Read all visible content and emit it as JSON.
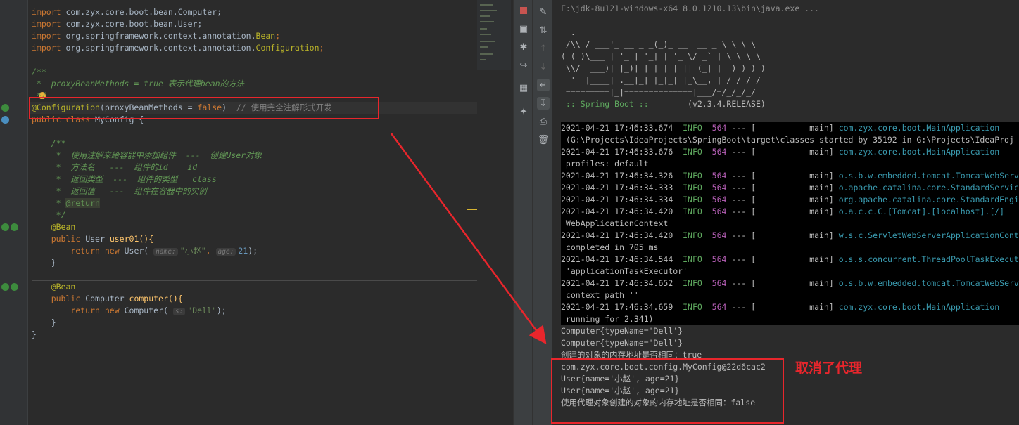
{
  "editor": {
    "imports": [
      "com.zyx.core.boot.bean.Computer;",
      "com.zyx.core.boot.bean.User;",
      "org.springframework.context.annotation.",
      "org.springframework.context.annotation."
    ],
    "import_kw": "import",
    "import_bean": "Bean",
    "import_conf": "Configuration",
    "semicolon": ";",
    "doc_open": "/**",
    "doc_proxy": " *  proxyBeanMethods = true 表示代理bean的方法",
    "doc_close": " */",
    "config_ann": "@Configuration",
    "config_param": "proxyBeanMethods",
    "config_eq": " = ",
    "config_val": "false",
    "config_close": ")",
    "config_open": "(",
    "config_comment": "// 使用完全注解形式开发",
    "class_decl_kw1": "public",
    "class_decl_kw2": "class",
    "class_name": "MyConfig",
    "brace_open": " {",
    "jd1": " *  使用注解来给容器中添加组件  ---  创建User对象",
    "jd2": " *  方法名   ---  组件的id    id",
    "jd3": " *  返回类型  ---  组件的类型   class",
    "jd4": " *  返回值   ---  组件在容器中的实例",
    "jd5_star": " * ",
    "jd5_tag": "@return",
    "bean_ann": "@Bean",
    "m1_sig_type": "User",
    "m1_name": "user01",
    "m1_parens": "(){",
    "ret_kw": "return",
    "new_kw": "new",
    "user_ctor": "User(",
    "hint_name": "name:",
    "user_arg1": "\"小赵\"",
    "comma": ",",
    "hint_age": "age:",
    "user_arg2": "21",
    "call_end": ");",
    "close_brace": "}",
    "m2_sig_type": "Computer",
    "m2_name": "computer",
    "comp_ctor": "Computer(",
    "hint_s": "s:",
    "comp_arg": "\"Dell\"",
    "class_close": "}"
  },
  "console": {
    "java_path": "F:\\jdk-8u121-windows-x64_8.0.1210.13\\bin\\java.exe ...",
    "banner": [
      "  .   ____          _            __ _ _",
      " /\\\\ / ___'_ __ _ _(_)_ __  __ _ \\ \\ \\ \\",
      "( ( )\\___ | '_ | '_| | '_ \\/ _` | \\ \\ \\ \\",
      " \\\\/  ___)| |_)| | | | | || (_| |  ) ) ) )",
      "  '  |____| .__|_| |_|_| |_\\__, | / / / /",
      " =========|_|==============|___/=/_/_/_/"
    ],
    "spring_boot_tag": " :: Spring Boot :: ",
    "spring_boot_ver": "       (v2.3.4.RELEASE)",
    "logs": [
      {
        "ts": "2021-04-21 17:46:33.674",
        "lvl": "INFO",
        "pid": "564",
        "mid": " --- [           main] ",
        "logger": "com.zyx.core.boot.MainApplication        "
      },
      {
        "cont": " (G:\\Projects\\IdeaProjects\\SpringBoot\\target\\classes started by 35192 in G:\\Projects\\IdeaProj"
      },
      {
        "ts": "2021-04-21 17:46:33.676",
        "lvl": "INFO",
        "pid": "564",
        "mid": " --- [           main] ",
        "logger": "com.zyx.core.boot.MainApplication        "
      },
      {
        "cont": " profiles: default"
      },
      {
        "ts": "2021-04-21 17:46:34.326",
        "lvl": "INFO",
        "pid": "564",
        "mid": " --- [           main] ",
        "logger": "o.s.b.w.embedded.tomcat.TomcatWebServ"
      },
      {
        "ts": "2021-04-21 17:46:34.333",
        "lvl": "INFO",
        "pid": "564",
        "mid": " --- [           main] ",
        "logger": "o.apache.catalina.core.StandardServic"
      },
      {
        "ts": "2021-04-21 17:46:34.334",
        "lvl": "INFO",
        "pid": "564",
        "mid": " --- [           main] ",
        "logger": "org.apache.catalina.core.StandardEngi"
      },
      {
        "ts": "2021-04-21 17:46:34.420",
        "lvl": "INFO",
        "pid": "564",
        "mid": " --- [           main] ",
        "logger": "o.a.c.c.C.[Tomcat].[localhost].[/]   "
      },
      {
        "cont": " WebApplicationContext"
      },
      {
        "ts": "2021-04-21 17:46:34.420",
        "lvl": "INFO",
        "pid": "564",
        "mid": " --- [           main] ",
        "logger": "w.s.c.ServletWebServerApplicationCont"
      },
      {
        "cont": " completed in 705 ms"
      },
      {
        "ts": "2021-04-21 17:46:34.544",
        "lvl": "INFO",
        "pid": "564",
        "mid": " --- [           main] ",
        "logger": "o.s.s.concurrent.ThreadPoolTaskExecut"
      },
      {
        "cont": " 'applicationTaskExecutor'"
      },
      {
        "ts": "2021-04-21 17:46:34.652",
        "lvl": "INFO",
        "pid": "564",
        "mid": " --- [           main] ",
        "logger": "o.s.b.w.embedded.tomcat.TomcatWebServ"
      },
      {
        "cont": " context path ''"
      },
      {
        "ts": "2021-04-21 17:46:34.659",
        "lvl": "INFO",
        "pid": "564",
        "mid": " --- [           main] ",
        "logger": "com.zyx.core.boot.MainApplication        "
      },
      {
        "cont": " running for 2.341)"
      }
    ],
    "output": [
      "Computer{typeName='Dell'}",
      "Computer{typeName='Dell'}",
      "创建的对象的内存地址是否相同：true",
      "com.zyx.core.boot.config.MyConfig@22d6cac2",
      "User{name='小赵', age=21}",
      "User{name='小赵', age=21}",
      "使用代理对象创建的对象的内存地址是否相同：false"
    ]
  },
  "annotation_note": "取消了代理",
  "colors": {
    "highlight_box": "#e8262c",
    "background": "#2b2b2b"
  }
}
